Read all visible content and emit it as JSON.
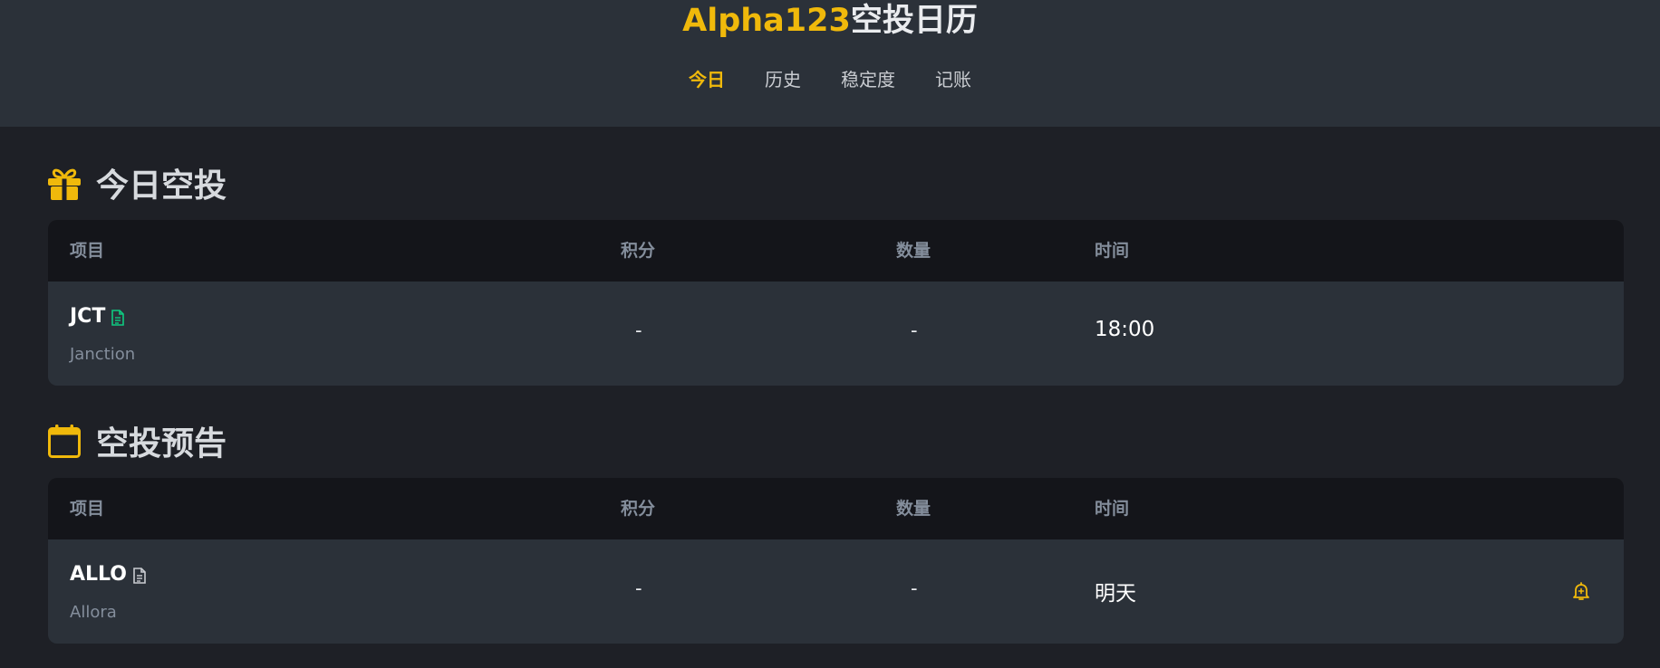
{
  "header": {
    "title_brand": "Alpha123",
    "title_rest": "空投日历",
    "nav": [
      {
        "label": "今日",
        "active": true
      },
      {
        "label": "历史",
        "active": false
      },
      {
        "label": "稳定度",
        "active": false
      },
      {
        "label": "记账",
        "active": false
      }
    ]
  },
  "colors": {
    "accent": "#f0b90b",
    "page_bg": "#1e2026",
    "panel_bg": "#2b3139",
    "table_head_bg": "#14151a",
    "muted_text": "#848e9c",
    "doc_icon_green": "#0ecb81"
  },
  "today": {
    "title": "今日空投",
    "icon": "gift-icon",
    "columns": [
      "项目",
      "积分",
      "数量",
      "时间"
    ],
    "rows": [
      {
        "symbol": "JCT",
        "name": "Janction",
        "points": "-",
        "amount": "-",
        "time": "18:00",
        "doc_icon": "document-icon"
      }
    ]
  },
  "upcoming": {
    "title": "空投预告",
    "icon": "calendar-icon",
    "columns": [
      "项目",
      "积分",
      "数量",
      "时间"
    ],
    "rows": [
      {
        "symbol": "ALLO",
        "name": "Allora",
        "points": "-",
        "amount": "-",
        "time": "明天",
        "doc_icon": "document-icon",
        "action_icon": "bell-plus-icon"
      }
    ]
  }
}
